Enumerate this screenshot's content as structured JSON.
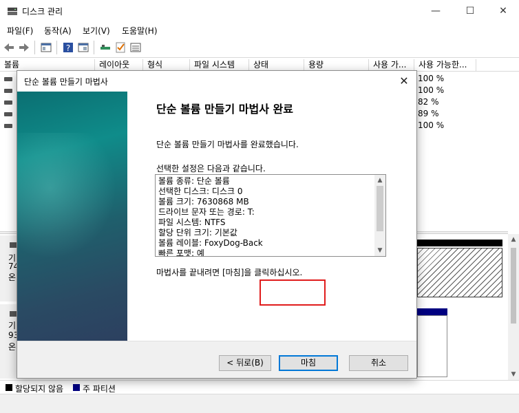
{
  "window": {
    "title": "디스크 관리",
    "minimize": "—",
    "maximize": "☐",
    "close": "✕"
  },
  "menu": [
    "파일(F)",
    "동작(A)",
    "보기(V)",
    "도움말(H)"
  ],
  "columns": [
    "볼륨",
    "레이아웃",
    "형식",
    "파일 시스템",
    "상태",
    "용량",
    "사용 가...",
    "사용 가능한..."
  ],
  "volume_free_percent": [
    "100 %",
    "100 %",
    "82 %",
    "89 %",
    "100 %"
  ],
  "disks": [
    {
      "label_top": "기",
      "label_mid": "74",
      "label_bot": "온"
    },
    {
      "label_top": "기",
      "label_mid": "93",
      "label_bot": "온"
    }
  ],
  "legend": [
    {
      "label": "할당되지 않음",
      "color": "#000000"
    },
    {
      "label": "주 파티션",
      "color": "#000080"
    }
  ],
  "dialog": {
    "title": "단순 볼륨 만들기 마법사",
    "heading": "단순 볼륨 만들기 마법사 완료",
    "completed_text": "단순 볼륨 만들기 마법사를 완료했습니다.",
    "settings_intro": "선택한 설정은 다음과 같습니다.",
    "summary": [
      "볼륨 종류: 단순 볼륨",
      "선택한 디스크: 디스크 0",
      "볼륨 크기: 7630868 MB",
      "드라이브 문자 또는 경로: T:",
      "파일 시스템: NTFS",
      "할당 단위 크기: 기본값",
      "볼륨 레이블: FoxyDog-Back",
      "빠른 포맷: 예"
    ],
    "finish_hint": "마법사를 끝내려면 [마침]을 클릭하십시오.",
    "back_button": "< 뒤로(B)",
    "finish_button": "마침",
    "cancel_button": "취소"
  }
}
